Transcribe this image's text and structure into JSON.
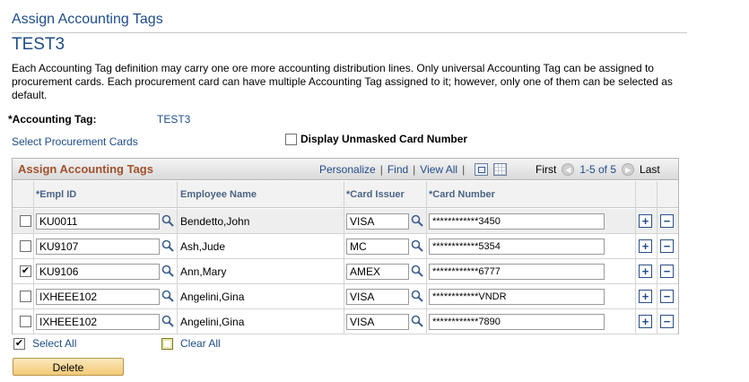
{
  "page": {
    "header": "Assign Accounting Tags",
    "title": "TEST3",
    "description": "Each Accounting Tag definition may carry one ore more accounting distribution lines. Only universal Accounting Tag can be assigned to procurement cards. Each procurement card can have multiple Accounting Tag assigned to it; however, only one of them can be selected as default."
  },
  "accounting_tag": {
    "label": "*Accounting Tag:",
    "value": "TEST3"
  },
  "select_cards_link": "Select Procurement Cards",
  "display_unmasked": {
    "label": "Display Unmasked Card Number",
    "checked": false
  },
  "grid": {
    "title": "Assign Accounting Tags",
    "toolbar": {
      "personalize": "Personalize",
      "find": "Find",
      "view_all": "View All"
    },
    "nav": {
      "first": "First",
      "range": "1-5 of 5",
      "last": "Last"
    },
    "columns": {
      "empl_id": "*Empl ID",
      "employee_name": "Employee Name",
      "card_issuer": "*Card Issuer",
      "card_number": "*Card Number"
    },
    "rows": [
      {
        "checked": false,
        "empl_id": "KU0011",
        "name": "Bendetto,John",
        "issuer": "VISA",
        "card": "************3450"
      },
      {
        "checked": false,
        "empl_id": "KU9107",
        "name": "Ash,Jude",
        "issuer": "MC",
        "card": "************5354"
      },
      {
        "checked": true,
        "empl_id": "KU9106",
        "name": "Ann,Mary",
        "issuer": "AMEX",
        "card": "************6777"
      },
      {
        "checked": false,
        "empl_id": "IXHEEE102",
        "name": "Angelini,Gina",
        "issuer": "VISA",
        "card": "************VNDR"
      },
      {
        "checked": false,
        "empl_id": "IXHEEE102",
        "name": "Angelini,Gina",
        "issuer": "VISA",
        "card": "************7890"
      }
    ]
  },
  "select_all": "Select All",
  "clear_all": "Clear All",
  "delete_button": "Delete"
}
